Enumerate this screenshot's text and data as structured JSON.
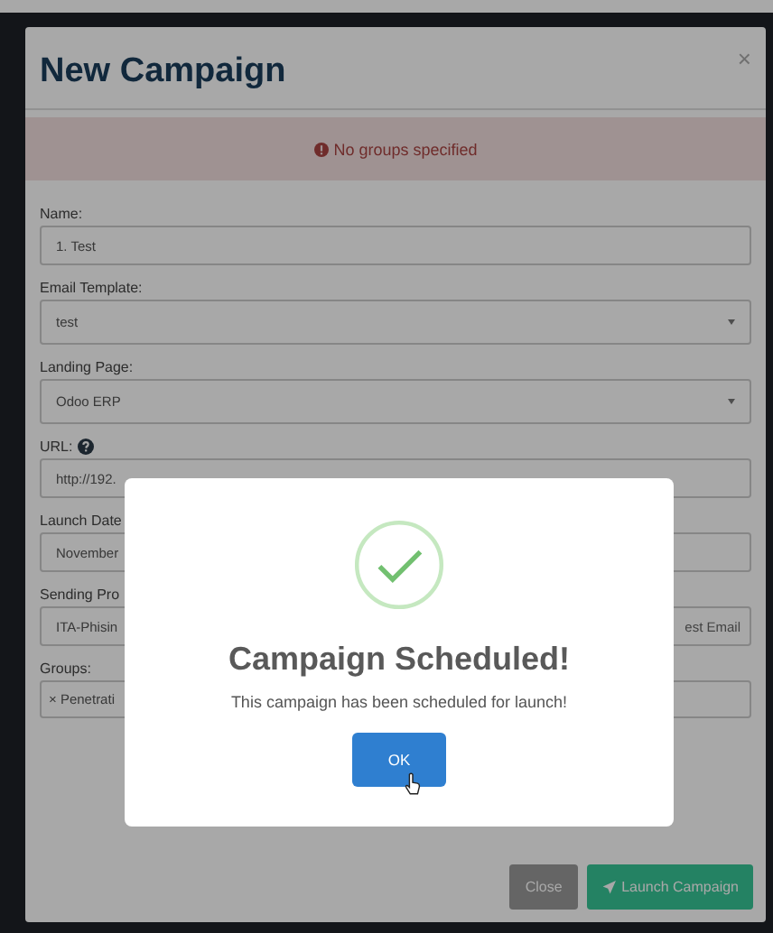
{
  "window": {
    "title": "New Campaign",
    "close": "×"
  },
  "alert": {
    "message": "No groups specified"
  },
  "fields": [
    {
      "label": "Name:",
      "value": "1. Test",
      "kind": "input"
    },
    {
      "label": "Email Template:",
      "value": "test",
      "kind": "select"
    },
    {
      "label": "Landing Page:",
      "value": "Odoo ERP",
      "kind": "select"
    },
    {
      "label": "URL:",
      "value": "http://192.",
      "kind": "input",
      "help": true
    },
    {
      "label": "Launch Date",
      "value": "November",
      "kind": "input"
    },
    {
      "label": "Sending Pro",
      "value": "ITA-Phisin",
      "kind": "input",
      "side_button": "est Email"
    },
    {
      "label": "Groups:",
      "value": "× Penetrati",
      "kind": "tags"
    }
  ],
  "buttons": [
    {
      "label": "Close",
      "kind": "secondary"
    },
    {
      "label": "Launch Campaign",
      "kind": "primary"
    }
  ],
  "dialog": {
    "title": "Campaign Scheduled!",
    "message": "This campaign has been scheduled for launch!",
    "button": "OK"
  }
}
